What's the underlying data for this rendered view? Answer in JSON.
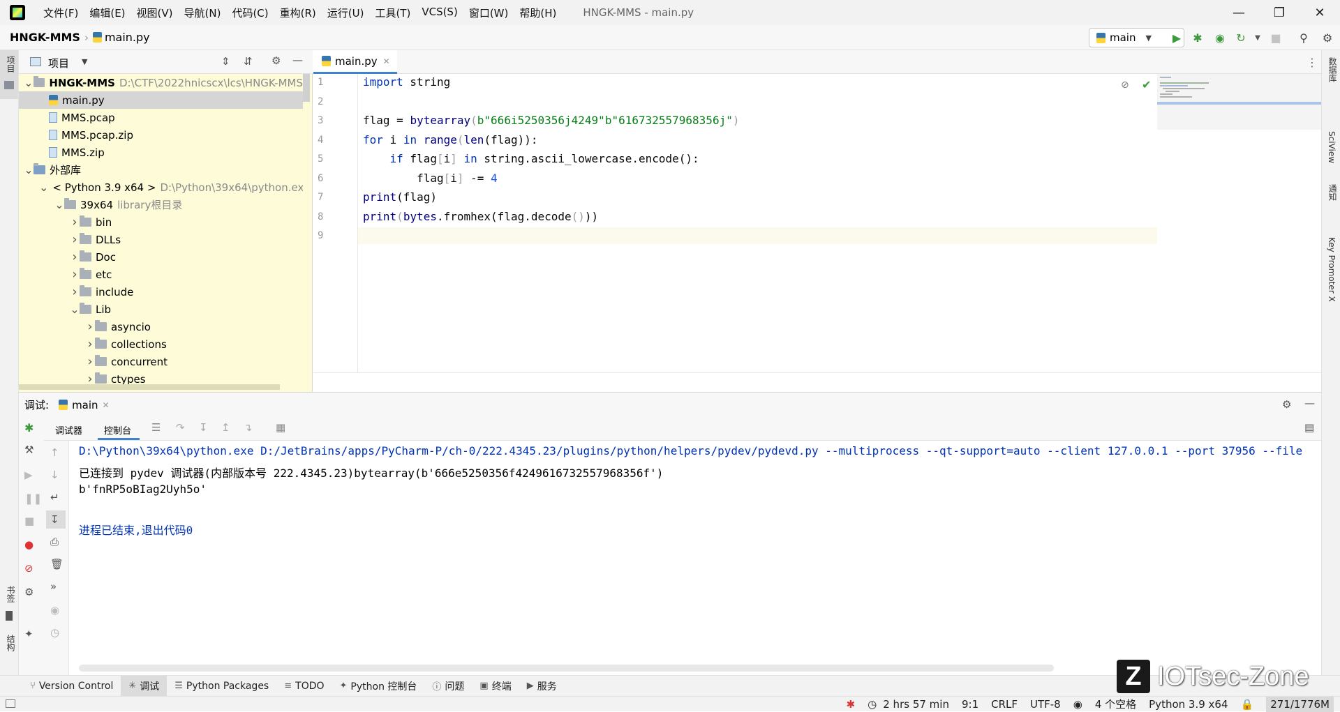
{
  "app": {
    "title": "HNGK-MMS - main.py",
    "menu": [
      "文件(F)",
      "编辑(E)",
      "视图(V)",
      "导航(N)",
      "代码(C)",
      "重构(R)",
      "运行(U)",
      "工具(T)",
      "VCS(S)",
      "窗口(W)",
      "帮助(H)"
    ]
  },
  "navbar": {
    "project": "HNGK-MMS",
    "file": "main.py",
    "run_config": "main"
  },
  "left_strip": {
    "top": "项目",
    "bookmarks": "书签",
    "structure": "结构"
  },
  "right_strip": [
    "数据库",
    "SciView",
    "通知",
    "Key Promoter X"
  ],
  "project_panel": {
    "title": "项目",
    "tree": [
      {
        "label": "HNGK-MMS",
        "hint": "D:\\CTF\\2022hnicscx\\lcs\\HNGK-MMS",
        "level": 0,
        "kind": "folder",
        "expanded": true,
        "bold": true
      },
      {
        "label": "main.py",
        "hint": "",
        "level": 1,
        "kind": "py",
        "selected": true
      },
      {
        "label": "MMS.pcap",
        "hint": "",
        "level": 1,
        "kind": "file"
      },
      {
        "label": "MMS.pcap.zip",
        "hint": "",
        "level": 1,
        "kind": "zip"
      },
      {
        "label": "MMS.zip",
        "hint": "",
        "level": 1,
        "kind": "zip"
      },
      {
        "label": "外部库",
        "hint": "",
        "level": 0,
        "kind": "lib",
        "expanded": true
      },
      {
        "label": "< Python 3.9 x64 >",
        "hint": "D:\\Python\\39x64\\python.ex",
        "level": 1,
        "kind": "python",
        "expanded": true
      },
      {
        "label": "39x64",
        "hint": "library根目录",
        "level": 2,
        "kind": "folder",
        "expanded": true
      },
      {
        "label": "bin",
        "hint": "",
        "level": 3,
        "kind": "folder",
        "expanded": false
      },
      {
        "label": "DLLs",
        "hint": "",
        "level": 3,
        "kind": "folder",
        "expanded": false
      },
      {
        "label": "Doc",
        "hint": "",
        "level": 3,
        "kind": "folder",
        "expanded": false
      },
      {
        "label": "etc",
        "hint": "",
        "level": 3,
        "kind": "folder",
        "expanded": false
      },
      {
        "label": "include",
        "hint": "",
        "level": 3,
        "kind": "folder",
        "expanded": false
      },
      {
        "label": "Lib",
        "hint": "",
        "level": 3,
        "kind": "folder",
        "expanded": true
      },
      {
        "label": "asyncio",
        "hint": "",
        "level": 4,
        "kind": "folder",
        "expanded": false
      },
      {
        "label": "collections",
        "hint": "",
        "level": 4,
        "kind": "folder",
        "expanded": false
      },
      {
        "label": "concurrent",
        "hint": "",
        "level": 4,
        "kind": "folder",
        "expanded": false
      },
      {
        "label": "ctypes",
        "hint": "",
        "level": 4,
        "kind": "folder",
        "expanded": false
      }
    ]
  },
  "editor": {
    "tab": "main.py",
    "line_numbers": [
      "1",
      "2",
      "3",
      "4",
      "5",
      "6",
      "7",
      "8",
      "9"
    ],
    "lines": [
      [
        {
          "t": "import",
          "c": "kw"
        },
        {
          "t": " string",
          "c": ""
        }
      ],
      [],
      [
        {
          "t": "flag = ",
          "c": ""
        },
        {
          "t": "bytearray",
          "c": "bi"
        },
        {
          "t": "(",
          "c": "br"
        },
        {
          "t": "b\"666i5250356j4249\"",
          "c": "st"
        },
        {
          "t": "b\"616732557968356j\"",
          "c": "st"
        },
        {
          "t": ")",
          "c": "br"
        }
      ],
      [
        {
          "t": "for",
          "c": "kw"
        },
        {
          "t": " i ",
          "c": ""
        },
        {
          "t": "in",
          "c": "kw"
        },
        {
          "t": " ",
          "c": ""
        },
        {
          "t": "range",
          "c": "bi"
        },
        {
          "t": "(",
          "c": "br"
        },
        {
          "t": "len",
          "c": "bi"
        },
        {
          "t": "(flag)):",
          "c": ""
        }
      ],
      [
        {
          "t": "    ",
          "c": ""
        },
        {
          "t": "if",
          "c": "kw"
        },
        {
          "t": " flag",
          "c": ""
        },
        {
          "t": "[",
          "c": "br"
        },
        {
          "t": "i",
          "c": ""
        },
        {
          "t": "]",
          "c": "br"
        },
        {
          "t": " ",
          "c": ""
        },
        {
          "t": "in",
          "c": "kw"
        },
        {
          "t": " string.ascii_lowercase.encode():",
          "c": ""
        }
      ],
      [
        {
          "t": "        flag",
          "c": ""
        },
        {
          "t": "[",
          "c": "br"
        },
        {
          "t": "i",
          "c": ""
        },
        {
          "t": "]",
          "c": "br"
        },
        {
          "t": " -= ",
          "c": ""
        },
        {
          "t": "4",
          "c": "nu"
        }
      ],
      [
        {
          "t": "print",
          "c": "bi"
        },
        {
          "t": "(flag)",
          "c": ""
        }
      ],
      [
        {
          "t": "print",
          "c": "bi"
        },
        {
          "t": "(",
          "c": "br"
        },
        {
          "t": "bytes",
          "c": "bi"
        },
        {
          "t": ".fromhex(flag.decode",
          "c": ""
        },
        {
          "t": "()",
          "c": "br"
        },
        {
          "t": "))",
          "c": ""
        }
      ],
      []
    ]
  },
  "debug": {
    "label": "调试:",
    "run_tab": "main",
    "tabs": [
      "调试器",
      "控制台"
    ],
    "console": [
      {
        "text": "D:\\Python\\39x64\\python.exe D:/JetBrains/apps/PyCharm-P/ch-0/222.4345.23/plugins/python/helpers/pydev/pydevd.py --multiprocess --qt-support=auto --client 127.0.0.1 --port 37956 --file",
        "style": "blue"
      },
      {
        "text": "已连接到 pydev 调试器(内部版本号 222.4345.23)bytearray(b'666e5250356f4249616732557968356f')",
        "style": ""
      },
      {
        "text": "b'fnRP5oBIag2Uyh5o'",
        "style": ""
      },
      {
        "text": "",
        "style": ""
      },
      {
        "text": "进程已结束,退出代码0",
        "style": "blue"
      }
    ]
  },
  "bottom_tabs": [
    {
      "label": "Version Control",
      "icon": "branch-icon"
    },
    {
      "label": "调试",
      "icon": "bug-icon",
      "active": true
    },
    {
      "label": "Python Packages",
      "icon": "layers-icon"
    },
    {
      "label": "TODO",
      "icon": "list-icon"
    },
    {
      "label": "Python 控制台",
      "icon": "python-icon"
    },
    {
      "label": "问题",
      "icon": "info-icon"
    },
    {
      "label": "终端",
      "icon": "terminal-icon"
    },
    {
      "label": "服务",
      "icon": "play-icon"
    }
  ],
  "status": {
    "time": "2 hrs 57 min",
    "position": "9:1",
    "line_sep": "CRLF",
    "encoding": "UTF-8",
    "indent": "4 个空格",
    "interpreter": "Python 3.9 x64",
    "memory": "271/1776M"
  },
  "watermark": {
    "logo": "Z",
    "text": "IOTsec-Zone"
  }
}
